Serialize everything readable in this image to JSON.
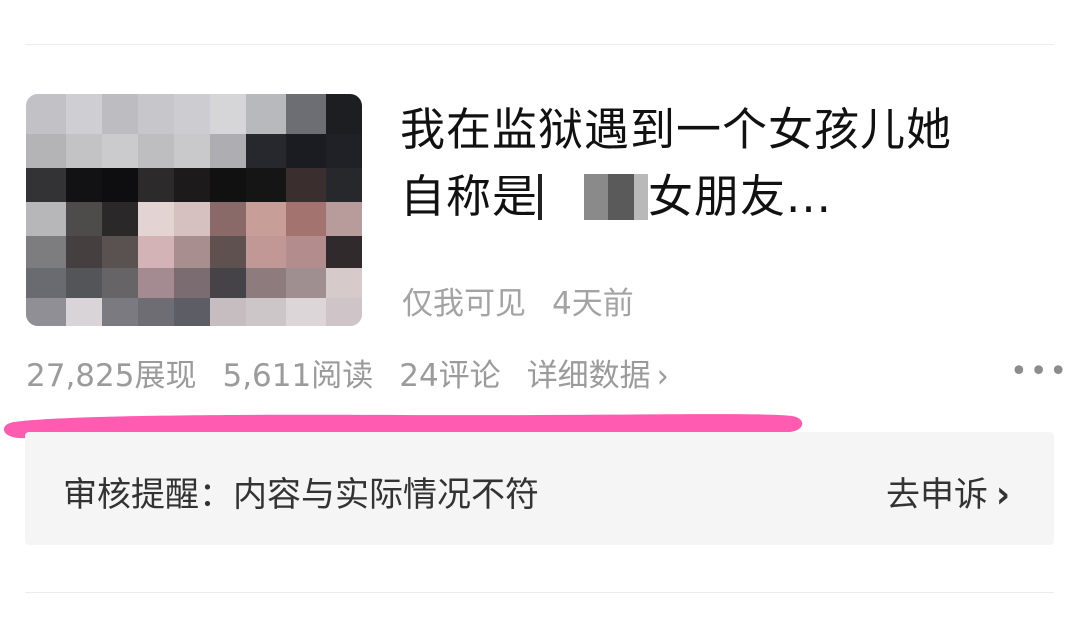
{
  "article": {
    "title_line1": "我在监狱遇到一个女孩儿她",
    "title_line2_start": "自称是",
    "title_line2_end": "女朋友...",
    "visibility": "仅我可见",
    "time": "4天前"
  },
  "stats": {
    "impressions": "27,825展现",
    "reads": "5,611阅读",
    "comments": "24评论",
    "detail_label": "详细数据",
    "chevron": "›",
    "more": "•••"
  },
  "notice": {
    "text": "审核提醒：内容与实际情况不符",
    "appeal_label": "去申诉",
    "chevron": "›"
  },
  "colors": {
    "highlight": "#ff5bb0",
    "notice_bg": "#f5f5f5",
    "title": "#111111",
    "muted": "#9b9b9b"
  },
  "icons": {
    "thumbnail": "pixelated-photo",
    "more": "more-dots-icon",
    "chevron": "chevron-right-icon"
  }
}
